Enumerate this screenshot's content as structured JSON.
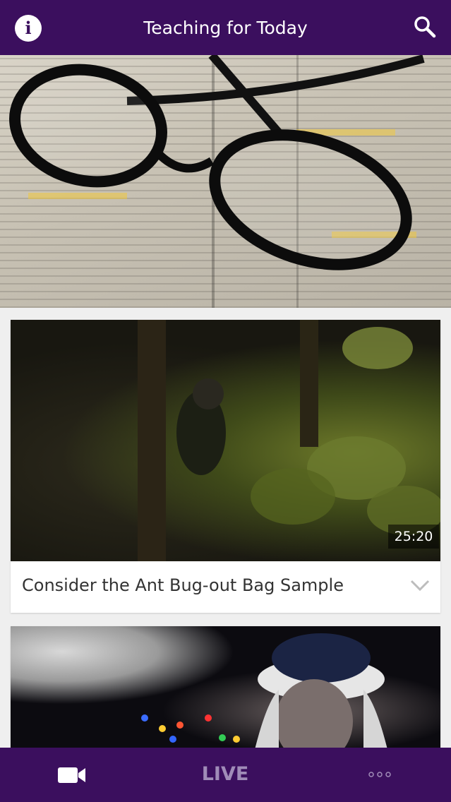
{
  "header": {
    "title": "Teaching for Today",
    "info_icon": "info-icon",
    "search_icon": "search-icon"
  },
  "hero": {
    "image": "open-bible-with-reading-glasses"
  },
  "videos": [
    {
      "title": "Consider the Ant Bug-out Bag Sample",
      "duration": "25:20",
      "thumbnail": "man-in-dark-forest",
      "expand_icon": "chevron-down-icon"
    },
    {
      "thumbnail": "man-in-winter-hat-with-lights"
    }
  ],
  "bottom_nav": {
    "video_icon": "video-camera-icon",
    "live_label": "LIVE",
    "more_icon": "more-dots-icon"
  },
  "colors": {
    "primary": "#3b0f5e",
    "live_text": "#a08cb8",
    "background": "#efefef"
  }
}
